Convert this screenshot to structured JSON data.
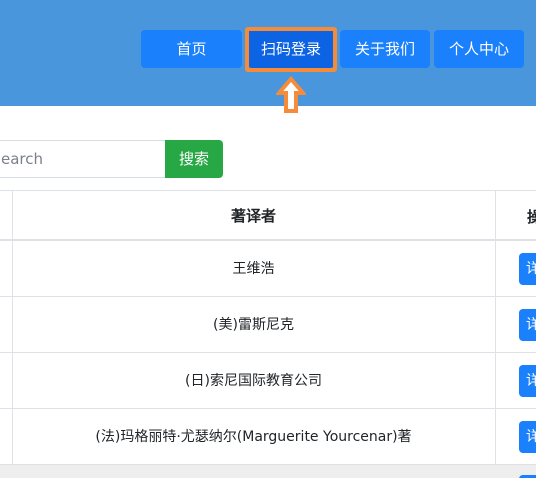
{
  "nav": {
    "home": "首页",
    "scan_login": "扫码登录",
    "about": "关于我们",
    "personal": "个人中心"
  },
  "search": {
    "placeholder": "earch",
    "button": "搜索"
  },
  "table": {
    "headers": {
      "author": "著译者",
      "operation": "操"
    },
    "rows": [
      {
        "author": "王维浩",
        "action": "详"
      },
      {
        "author": "(美)雷斯尼克",
        "action": "详"
      },
      {
        "author": "(日)索尼国际教育公司",
        "action": "详"
      },
      {
        "author": "(法)玛格丽特·尤瑟纳尔(Marguerite Yourcenar)著",
        "action": "详"
      }
    ]
  },
  "colors": {
    "header_bg": "#4a96dd",
    "nav_button": "#1a80fb",
    "highlight": "#f68b3a",
    "search_button": "#28a745"
  },
  "annotations": {
    "highlight_arrow": "up-arrow-icon"
  }
}
